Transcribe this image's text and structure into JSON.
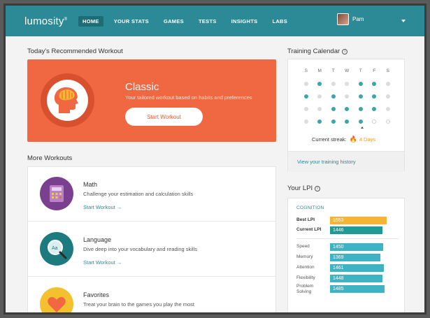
{
  "nav": {
    "logo": "lumosity",
    "items": [
      {
        "label": "HOME",
        "active": true
      },
      {
        "label": "YOUR STATS",
        "active": false
      },
      {
        "label": "GAMES",
        "active": false
      },
      {
        "label": "TESTS",
        "active": false
      },
      {
        "label": "INSIGHTS",
        "active": false
      },
      {
        "label": "LABS",
        "active": false
      }
    ],
    "user_name": "Pam"
  },
  "recommended": {
    "section_title": "Today's Recommended Workout",
    "title": "Classic",
    "subtitle": "Your tailored workout based on habits and preferences",
    "button_label": "Start Workout"
  },
  "more_workouts": {
    "section_title": "More Workouts",
    "items": [
      {
        "title": "Math",
        "desc": "Challenge your estimation and calculation skills",
        "link": "Start Workout →",
        "icon": "calculator-icon",
        "color": "#7b3f8f"
      },
      {
        "title": "Language",
        "desc": "Dive deep into your vocabulary and reading skills",
        "link": "Start Workout →",
        "icon": "magnifier-icon",
        "color": "#1d7b80"
      },
      {
        "title": "Favorites",
        "desc": "Treat your brain to the games you play the most",
        "link": "",
        "icon": "heart-icon",
        "color": "#f5c02e"
      }
    ]
  },
  "calendar": {
    "section_title": "Training Calendar",
    "days": [
      "S",
      "M",
      "T",
      "W",
      "T",
      "F",
      "S"
    ],
    "weeks": [
      [
        "off",
        "on",
        "off",
        "off",
        "on",
        "on",
        "off"
      ],
      [
        "on",
        "off",
        "on",
        "off",
        "on",
        "on",
        "off"
      ],
      [
        "off",
        "off",
        "on",
        "on",
        "on",
        "on",
        "off"
      ],
      [
        "off",
        "on",
        "on",
        "on",
        "on",
        "future",
        "future"
      ]
    ],
    "streak_label": "Current streak:",
    "streak_value": "4 Days",
    "history_link": "View your training history"
  },
  "lpi": {
    "section_title": "Your LPI",
    "category": "COGNITION",
    "rows": [
      {
        "label": "Best LPI",
        "value": "1553",
        "fraction": 0.88,
        "color": "#f5b431",
        "bold": true
      },
      {
        "label": "Current LPI",
        "value": "1446",
        "fraction": 0.82,
        "color": "#1f9a94",
        "bold": true
      },
      {
        "label": "Speed",
        "value": "1450",
        "fraction": 0.83,
        "color": "#3db3c3",
        "bold": false
      },
      {
        "label": "Memory",
        "value": "1369",
        "fraction": 0.78,
        "color": "#3db3c3",
        "bold": false
      },
      {
        "label": "Attention",
        "value": "1461",
        "fraction": 0.84,
        "color": "#3db3c3",
        "bold": false
      },
      {
        "label": "Flexibility",
        "value": "1448",
        "fraction": 0.82,
        "color": "#3db3c3",
        "bold": false
      },
      {
        "label": "Problem Solving",
        "value": "1485",
        "fraction": 0.85,
        "color": "#3db3c3",
        "bold": false
      }
    ]
  },
  "colors": {
    "brand": "#2b8a96",
    "accent": "#ef6841",
    "streak": "#f39c2b"
  }
}
